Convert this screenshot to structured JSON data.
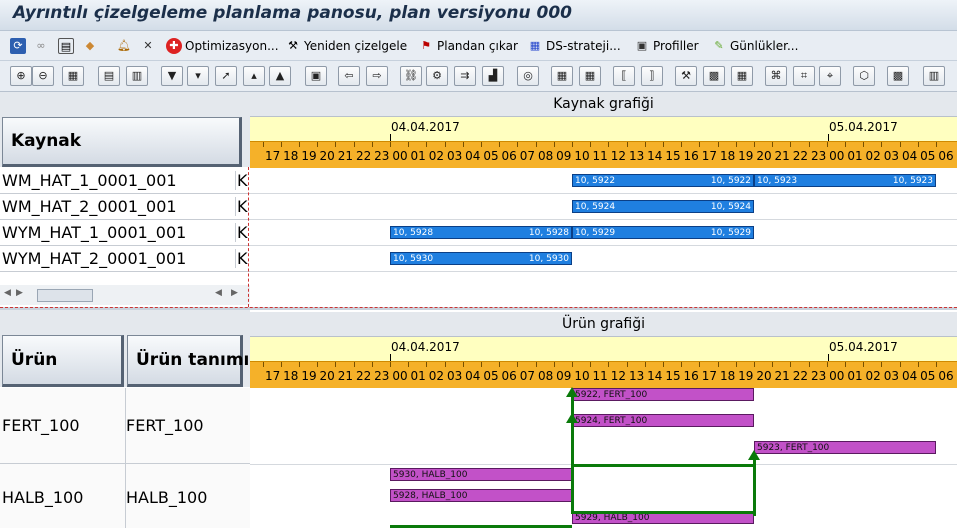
{
  "title": "Ayrıntılı çizelgeleme planlama panosu, plan versiyonu 000",
  "app_toolbar": [
    {
      "label": "Optimizasyon..."
    },
    {
      "label": "Yeniden çizelgele"
    },
    {
      "label": "Plandan çıkar"
    },
    {
      "label": "DS-strateji..."
    },
    {
      "label": "Profiller"
    },
    {
      "label": "Günlükler..."
    }
  ],
  "icon_toolbar": [
    "zoom-in-icon",
    "zoom-out-icon",
    "overview-icon",
    "list-icon",
    "list2-icon",
    "move-down-icon",
    "arrow-down-icon",
    "pointer-icon",
    "arrow-up-icon",
    "move-up-icon",
    "details-icon",
    "arrow-left-icon",
    "arrow-right-icon",
    "chain-icon",
    "resource-icon",
    "sequence-icon",
    "chart-icon",
    "rescale-icon",
    "table-icon",
    "table2-icon",
    "expand-icon",
    "collapse-icon",
    "network-icon",
    "display-icon",
    "grid-icon",
    "hierarchy-icon",
    "hierarchy2-icon",
    "hierarchy3-icon",
    "cube-icon",
    "palette-icon",
    "split-icon"
  ],
  "resource_chart": {
    "title": "Kaynak grafiği",
    "column_header": "Kaynak",
    "dates": [
      "04.04.2017",
      "05.04.2017"
    ],
    "hours": [
      "17",
      "18",
      "19",
      "20",
      "21",
      "22",
      "23",
      "00",
      "01",
      "02",
      "03",
      "04",
      "05",
      "06",
      "07",
      "08",
      "09",
      "10",
      "11",
      "12",
      "13",
      "14",
      "15",
      "16",
      "17",
      "18",
      "19",
      "20",
      "21",
      "22",
      "23",
      "00",
      "01",
      "02",
      "03",
      "04",
      "05",
      "06"
    ],
    "rows": [
      {
        "name": "WM_HAT_1_0001_001",
        "kind": "K"
      },
      {
        "name": "WM_HAT_2_0001_001",
        "kind": "K"
      },
      {
        "name": "WYM_HAT_1_0001_001",
        "kind": "K"
      },
      {
        "name": "WYM_HAT_2_0001_001",
        "kind": "K"
      }
    ],
    "bars": [
      {
        "row": 0,
        "start": 10,
        "end": 20,
        "left": "10, 5922",
        "right": "10, 5922"
      },
      {
        "row": 0,
        "start": 20,
        "end": 30,
        "left": "10, 5923",
        "right": "10, 5923"
      },
      {
        "row": 1,
        "start": 10,
        "end": 20,
        "left": "10, 5924",
        "right": "10, 5924"
      },
      {
        "row": 2,
        "start": 0,
        "end": 10,
        "left": "10, 5928",
        "right": "10, 5928"
      },
      {
        "row": 2,
        "start": 10,
        "end": 20,
        "left": "10, 5929",
        "right": "10, 5929"
      },
      {
        "row": 3,
        "start": 0,
        "end": 10,
        "left": "10, 5930",
        "right": "10, 5930"
      }
    ]
  },
  "product_chart": {
    "title": "Ürün grafiği",
    "column_header_1": "Ürün",
    "column_header_2": "Ürün tanımı",
    "dates": [
      "04.04.2017",
      "05.04.2017"
    ],
    "rows": [
      {
        "product": "FERT_100",
        "description": "FERT_100"
      },
      {
        "product": "HALB_100",
        "description": "HALB_100"
      }
    ],
    "bars": [
      {
        "start": 10,
        "end": 20,
        "label": "5922, FERT_100"
      },
      {
        "start": 10,
        "end": 20,
        "label": "5924, FERT_100"
      },
      {
        "start": 20,
        "end": 30,
        "label": "5923, FERT_100"
      },
      {
        "start": 0,
        "end": 10,
        "label": "5930, HALB_100"
      },
      {
        "start": 0,
        "end": 10,
        "label": "5928, HALB_100"
      },
      {
        "start": 10,
        "end": 20,
        "label": "5929, HALB_100"
      }
    ]
  },
  "colors": {
    "resource_bar": "#1f7fe0",
    "product_bar": "#c251c8",
    "pegging_line": "#0a7a0a",
    "hour_band": "#f5b129",
    "date_band": "#ffffc0"
  }
}
